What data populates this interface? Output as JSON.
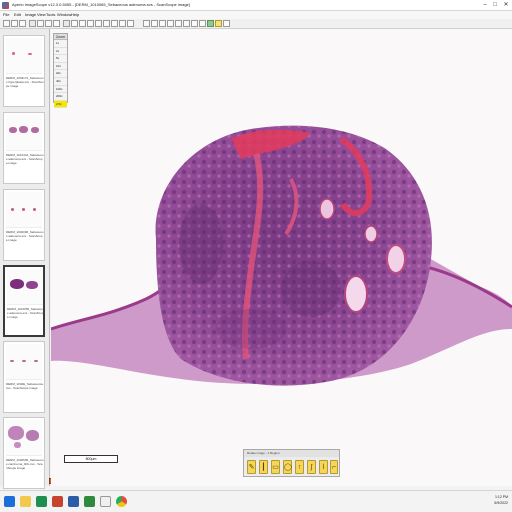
{
  "window": {
    "title": "Aperio ImageScope v12.3.0.5055 - [DERM_1010065_Sebaceous adenoma.svs - ScanScope image]",
    "minimize": "–",
    "maximize": "□",
    "close": "✕"
  },
  "menu": {
    "items": [
      "File",
      "Edit",
      "Image",
      "View",
      "Tools",
      "Window",
      "Help"
    ]
  },
  "thumbnails": [
    {
      "caption": "DERM_1004172_Sebaceous hyperplasia.svs - ScanScope image"
    },
    {
      "caption": "DERM_1012444_Sebaceous adenoma.svs - ScanScope image"
    },
    {
      "caption": "DERM_1002006_Sebaceous adenoma.svs - ScanScope image"
    },
    {
      "caption": "DERM_1010065_Sebaceous adenoma.svs - ScanScope image",
      "selected": true
    },
    {
      "caption": "DERM_1002E_Sebaceoma.svs - ScanScope image"
    },
    {
      "caption": "DERM_1002509_Sebaceous carcinoma_4DL.svs - ScanScope image"
    }
  ],
  "zoom": {
    "header": "Zoom",
    "levels": [
      "1x",
      "2x",
      "5x",
      "10x",
      "20x",
      "40x",
      "100x",
      "200x",
      "2.5x"
    ],
    "active_index": 8
  },
  "scalebar": {
    "label": "800µm"
  },
  "annotation_toolbar": {
    "title": "Rotate image - 1 Region",
    "tools": [
      "pen-tool",
      "ruler-tool",
      "rectangle-tool",
      "ellipse-tool",
      "arrow-tool",
      "freehand-tool",
      "polygon-tool",
      "negative-pen-tool"
    ]
  },
  "taskbar": {
    "time": "1:12 PM",
    "date": "6/9/2022"
  },
  "colors": {
    "accent_yellow": "#f6e600",
    "tissue_purple": "#8b3f86",
    "hemorrhage_red": "#e43b5c"
  }
}
